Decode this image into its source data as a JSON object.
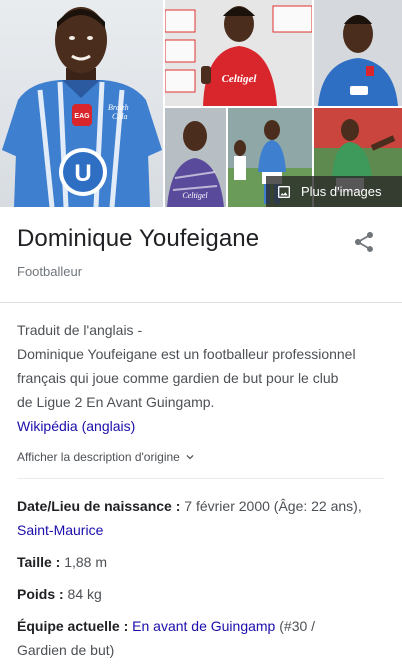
{
  "gallery": {
    "more_images_label": "Plus d'images",
    "shirt_text": "Breizh Cola",
    "sponsor": "Celtigel",
    "crest": "EAG",
    "crest_badge": "U"
  },
  "header": {
    "title": "Dominique Youfeigane",
    "subtitle": "Footballeur"
  },
  "description": {
    "source_note": "Traduit de l'anglais -",
    "text": "Dominique Youfeigane est un footballeur professionnel français qui joue comme gardien de but pour le club de Ligue 2 En Avant Guingamp.",
    "source_link": "Wikipédia (anglais)",
    "show_original": "Afficher la description d'origine"
  },
  "facts": [
    {
      "label": "Date/Lieu de naissance :",
      "value": " 7 février 2000 (Âge: 22 ans), ",
      "link": "Saint-Maurice",
      "after": ""
    },
    {
      "label": "Taille :",
      "value": " 1,88 m",
      "link": "",
      "after": ""
    },
    {
      "label": "Poids :",
      "value": " 84 kg",
      "link": "",
      "after": ""
    },
    {
      "label": "Équipe actuelle :",
      "value": " ",
      "link": "En avant de Guingamp",
      "after": " (#30 / Gardien de but)"
    }
  ],
  "colors": {
    "link": "#1a0dab",
    "text": "#202124",
    "muted": "#70757a",
    "kit_blue": "#2e6fc4",
    "kit_red": "#d9262c"
  }
}
